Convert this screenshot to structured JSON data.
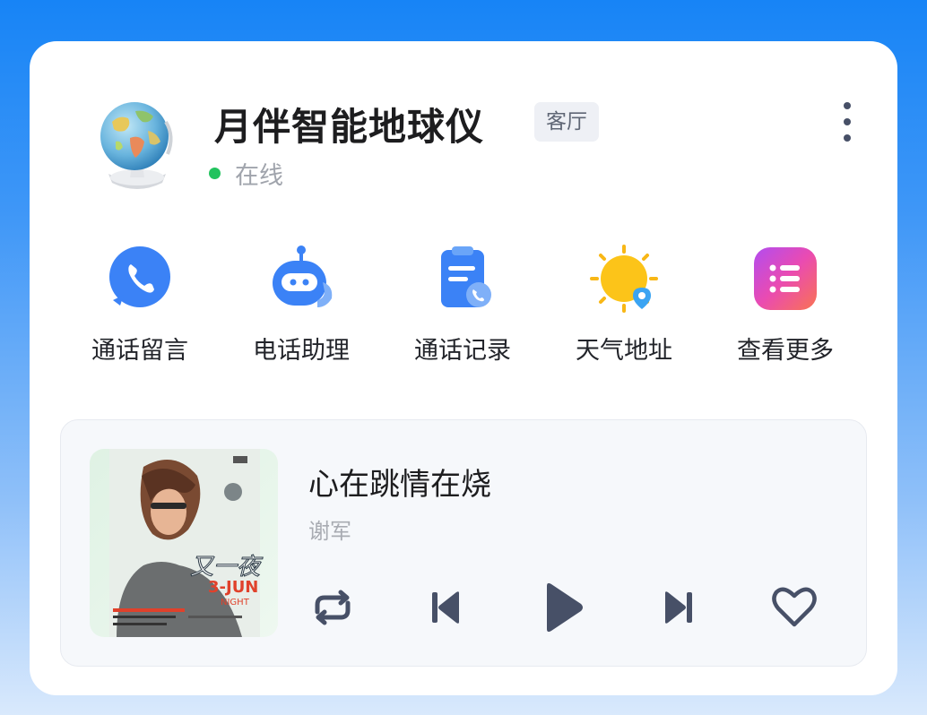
{
  "device": {
    "name": "月伴智能地球仪",
    "room": "客厅",
    "status": "在线",
    "status_color": "#22c35e",
    "image_icon": "globe-device"
  },
  "actions": [
    {
      "label": "通话留言",
      "icon": "phone-icon",
      "color": "#3b82f6"
    },
    {
      "label": "电话助理",
      "icon": "robot-icon",
      "color": "#3b82f6"
    },
    {
      "label": "通话记录",
      "icon": "call-log-icon",
      "color": "#3b82f6"
    },
    {
      "label": "天气地址",
      "icon": "weather-icon",
      "color": "#f8b716"
    },
    {
      "label": "查看更多",
      "icon": "more-list-icon",
      "color": "#d946ef"
    }
  ],
  "player": {
    "title": "心在跳情在烧",
    "artist": "谢军",
    "cover": {
      "line1": "又一夜",
      "line2": "3-JUN",
      "line3": "NIGHT"
    },
    "controls": [
      "repeat-icon",
      "previous-icon",
      "play-icon",
      "next-icon",
      "heart-icon"
    ]
  }
}
